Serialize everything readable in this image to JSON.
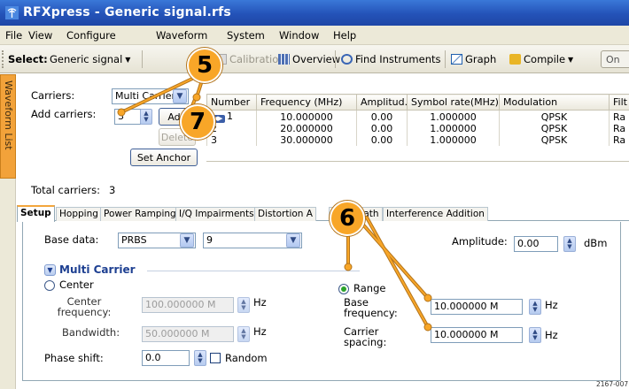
{
  "window": {
    "title": "RFXpress - Generic signal.rfs",
    "icon": "antenna-icon"
  },
  "menu": [
    "File",
    "View",
    "Configure",
    "Waveform",
    "System",
    "Window",
    "Help"
  ],
  "toolbar": {
    "select_label": "Select:",
    "select_value": "Generic signal",
    "calibration": "Calibration",
    "overview": "Overview",
    "find_instruments": "Find Instruments",
    "graph": "Graph",
    "compile": "Compile",
    "edge_label": "On"
  },
  "side_tab": "Waveform List",
  "carriers": {
    "carriers_label": "Carriers:",
    "carriers_value": "Multi Carrier",
    "add_label": "Add carriers:",
    "add_count": "3",
    "add_button": "Add",
    "delete_button": "Delete",
    "set_anchor_button": "Set Anchor",
    "total_label": "Total carriers:",
    "total_value": "3"
  },
  "table": {
    "headers": [
      "Number",
      "Frequency (MHz)",
      "Amplitud...",
      "Symbol rate(MHz)",
      "Modulation",
      "Filt"
    ],
    "rows": [
      [
        "1",
        "10.000000",
        "0.00",
        "1.000000",
        "QPSK",
        "Ra"
      ],
      [
        "2",
        "20.000000",
        "0.00",
        "1.000000",
        "QPSK",
        "Ra"
      ],
      [
        "3",
        "30.000000",
        "0.00",
        "1.000000",
        "QPSK",
        "Ra"
      ]
    ]
  },
  "tabs": [
    "Setup",
    "Hopping",
    "Power Ramping",
    "I/Q Impairments",
    "Distortion A",
    "Multi-Path",
    "Interference Addition"
  ],
  "setup": {
    "base_data_label": "Base data:",
    "base_data_value": "PRBS",
    "base_data_order": "9",
    "amplitude_label": "Amplitude:",
    "amplitude_value": "0.00",
    "amplitude_unit": "dBm",
    "group_title": "Multi Carrier",
    "center_option": "Center",
    "center_freq_label": "Center frequency:",
    "center_freq_value": "100.000000 M",
    "bandwidth_label": "Bandwidth:",
    "bandwidth_value": "50.000000 M",
    "hz": "Hz",
    "phase_shift_label": "Phase shift:",
    "phase_shift_value": "0.0",
    "random_label": "Random",
    "range_option": "Range",
    "base_freq_label": "Base frequency:",
    "base_freq_value": "10.000000 M",
    "carrier_spacing_label": "Carrier spacing:",
    "carrier_spacing_value": "10.000000 M"
  },
  "callouts": [
    "5",
    "6",
    "7"
  ],
  "figure_id": "2167-007",
  "colors": {
    "title_bar": "#2452b8",
    "callout": "#f8a628",
    "side_tab": "#f2a23a",
    "group_title": "#1d3f91"
  }
}
